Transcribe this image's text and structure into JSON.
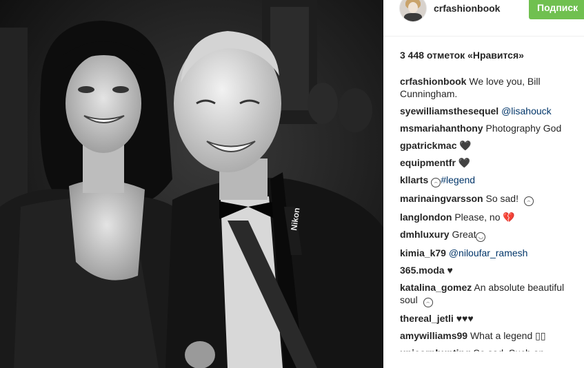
{
  "post": {
    "owner": "crfashionbook",
    "follow_label": "Подписк",
    "likes_text": "3 448 отметок «Нравится»"
  },
  "comments": [
    {
      "user": "crfashionbook",
      "parts": [
        {
          "t": "text",
          "v": " We love you, Bill Cunningham."
        }
      ]
    },
    {
      "user": "syewilliamsthesequel",
      "parts": [
        {
          "t": "mention",
          "v": " @lisahouck"
        }
      ]
    },
    {
      "user": "msmariahanthony",
      "parts": [
        {
          "t": "text",
          "v": " Photography God"
        }
      ]
    },
    {
      "user": "gpatrickmac",
      "parts": [
        {
          "t": "text",
          "v": " 🖤"
        }
      ]
    },
    {
      "user": "equipmentfr",
      "parts": [
        {
          "t": "text",
          "v": " 🖤"
        }
      ]
    },
    {
      "user": "kllarts",
      "parts": [
        {
          "t": "emoji",
          "v": "sad-face-icon"
        },
        {
          "t": "tag",
          "v": "#legend"
        }
      ]
    },
    {
      "user": "marinaingvarsson",
      "parts": [
        {
          "t": "text",
          "v": " So sad! "
        },
        {
          "t": "emoji",
          "v": "sad-face-icon"
        }
      ]
    },
    {
      "user": "langlondon",
      "parts": [
        {
          "t": "text",
          "v": " Please, no 💔"
        }
      ]
    },
    {
      "user": "dmhluxury",
      "parts": [
        {
          "t": "text",
          "v": " Great"
        },
        {
          "t": "emoji",
          "v": "smile-face-icon"
        }
      ]
    },
    {
      "user": "kimia_k79",
      "parts": [
        {
          "t": "mention",
          "v": " @niloufar_ramesh"
        }
      ]
    },
    {
      "user": "365.moda",
      "parts": [
        {
          "t": "text",
          "v": " ♥"
        }
      ]
    },
    {
      "user": "katalina_gomez",
      "parts": [
        {
          "t": "text",
          "v": " An absolute beautiful soul "
        },
        {
          "t": "emoji",
          "v": "sad-face-icon"
        }
      ]
    },
    {
      "user": "thereal_jetli",
      "parts": [
        {
          "t": "text",
          "v": " ♥♥♥"
        }
      ]
    },
    {
      "user": "amywilliams99",
      "parts": [
        {
          "t": "text",
          "v": " What a legend ▯▯"
        }
      ]
    },
    {
      "user": "unicornhunting",
      "parts": [
        {
          "t": "text",
          "v": " So sad. Such an"
        }
      ]
    }
  ],
  "colors": {
    "follow_button": "#70c050",
    "link": "#003569",
    "text": "#262626"
  }
}
